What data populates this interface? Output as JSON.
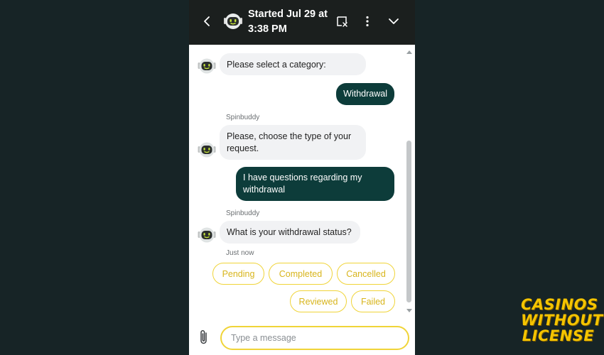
{
  "header": {
    "title": "Started Jul 29 at 3:38 PM",
    "back_icon": "chevron-left-icon",
    "avatar_icon": "robot-avatar-icon",
    "end_chat_icon": "end-chat-icon",
    "more_icon": "kebab-menu-icon",
    "minimize_icon": "chevron-down-icon"
  },
  "conversation": {
    "messages": [
      {
        "from": "bot",
        "text": "Please select a category:"
      },
      {
        "from": "user",
        "text": "Withdrawal"
      },
      {
        "from": "bot",
        "sender": "Spinbuddy",
        "text": "Please, choose the type of your request."
      },
      {
        "from": "user",
        "text": "I have questions regarding my withdrawal"
      },
      {
        "from": "bot",
        "sender": "Spinbuddy",
        "text": "What is your withdrawal status?",
        "time": "Just now"
      }
    ],
    "options": [
      "Pending",
      "Completed",
      "Cancelled",
      "Reviewed",
      "Failed"
    ]
  },
  "composer": {
    "placeholder": "Type a message",
    "value": "",
    "attach_icon": "paperclip-icon"
  },
  "watermark": {
    "line1": "CASINOS",
    "line2": "WITHOUT",
    "line3": "LICENSE"
  },
  "colors": {
    "page_background": "#172426",
    "header_background": "#1b1f1e",
    "user_bubble": "#0d3c3a",
    "bot_bubble": "#f1f2f4",
    "accent_yellow": "#f0d438",
    "watermark": "#f5c400"
  }
}
